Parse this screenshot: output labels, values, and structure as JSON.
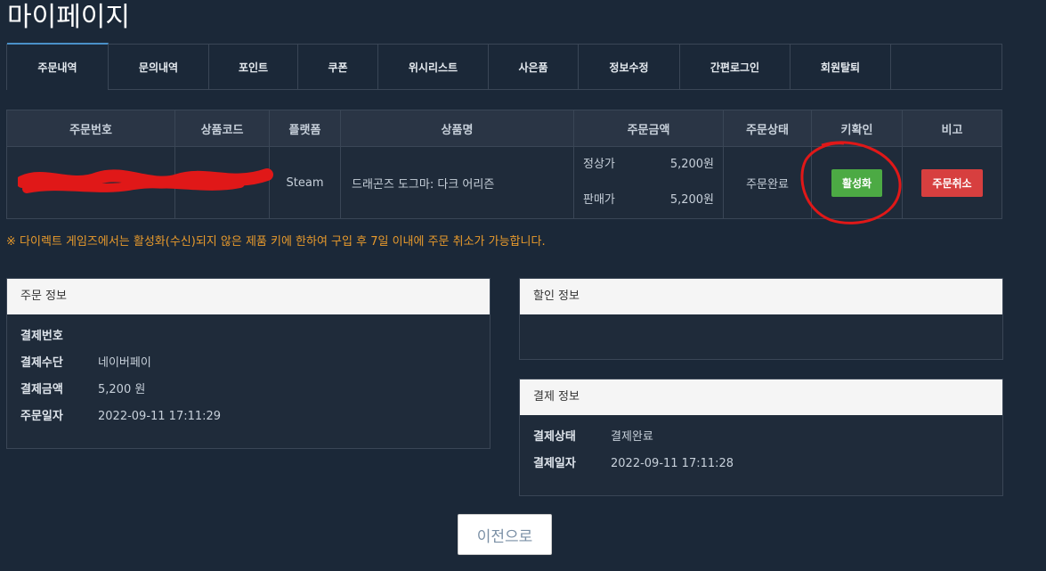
{
  "page": {
    "title": "마이페이지"
  },
  "tabs": [
    {
      "label": "주문내역"
    },
    {
      "label": "문의내역"
    },
    {
      "label": "포인트"
    },
    {
      "label": "쿠폰"
    },
    {
      "label": "위시리스트"
    },
    {
      "label": "사은품"
    },
    {
      "label": "정보수정"
    },
    {
      "label": "간편로그인"
    },
    {
      "label": "회원탈퇴"
    }
  ],
  "order_table": {
    "headers": [
      "주문번호",
      "상품코드",
      "플랫폼",
      "상품명",
      "주문금액",
      "주문상태",
      "키확인",
      "비고"
    ],
    "row": {
      "platform": "Steam",
      "product_name": "드래곤즈 도그마: 다크 어리즌",
      "regular_price_label": "정상가",
      "regular_price": "5,200원",
      "sale_price_label": "판매가",
      "sale_price": "5,200원",
      "status": "주문완료",
      "activate_label": "활성화",
      "cancel_label": "주문취소"
    }
  },
  "notice": "※ 다이렉트 게임즈에서는 활성화(수신)되지 않은 제품 키에 한하여 구입 후 7일 이내에 주문 취소가 가능합니다.",
  "order_info": {
    "title": "주문 정보",
    "payment_no_label": "결제번호",
    "method_label": "결제수단",
    "method": "네이버페이",
    "amount_label": "결제금액",
    "amount": "5,200 원",
    "date_label": "주문일자",
    "date": "2022-09-11 17:11:29"
  },
  "discount_info": {
    "title": "할인 정보"
  },
  "payment_info": {
    "title": "결제 정보",
    "status_label": "결제상태",
    "status": "결제완료",
    "date_label": "결제일자",
    "date": "2022-09-11 17:11:28"
  },
  "back_label": "이전으로",
  "colors": {
    "background": "#1b2838",
    "activate": "#4caa44",
    "cancel": "#d73f3f",
    "notice": "#e89a2c",
    "annotation": "#e01818"
  }
}
